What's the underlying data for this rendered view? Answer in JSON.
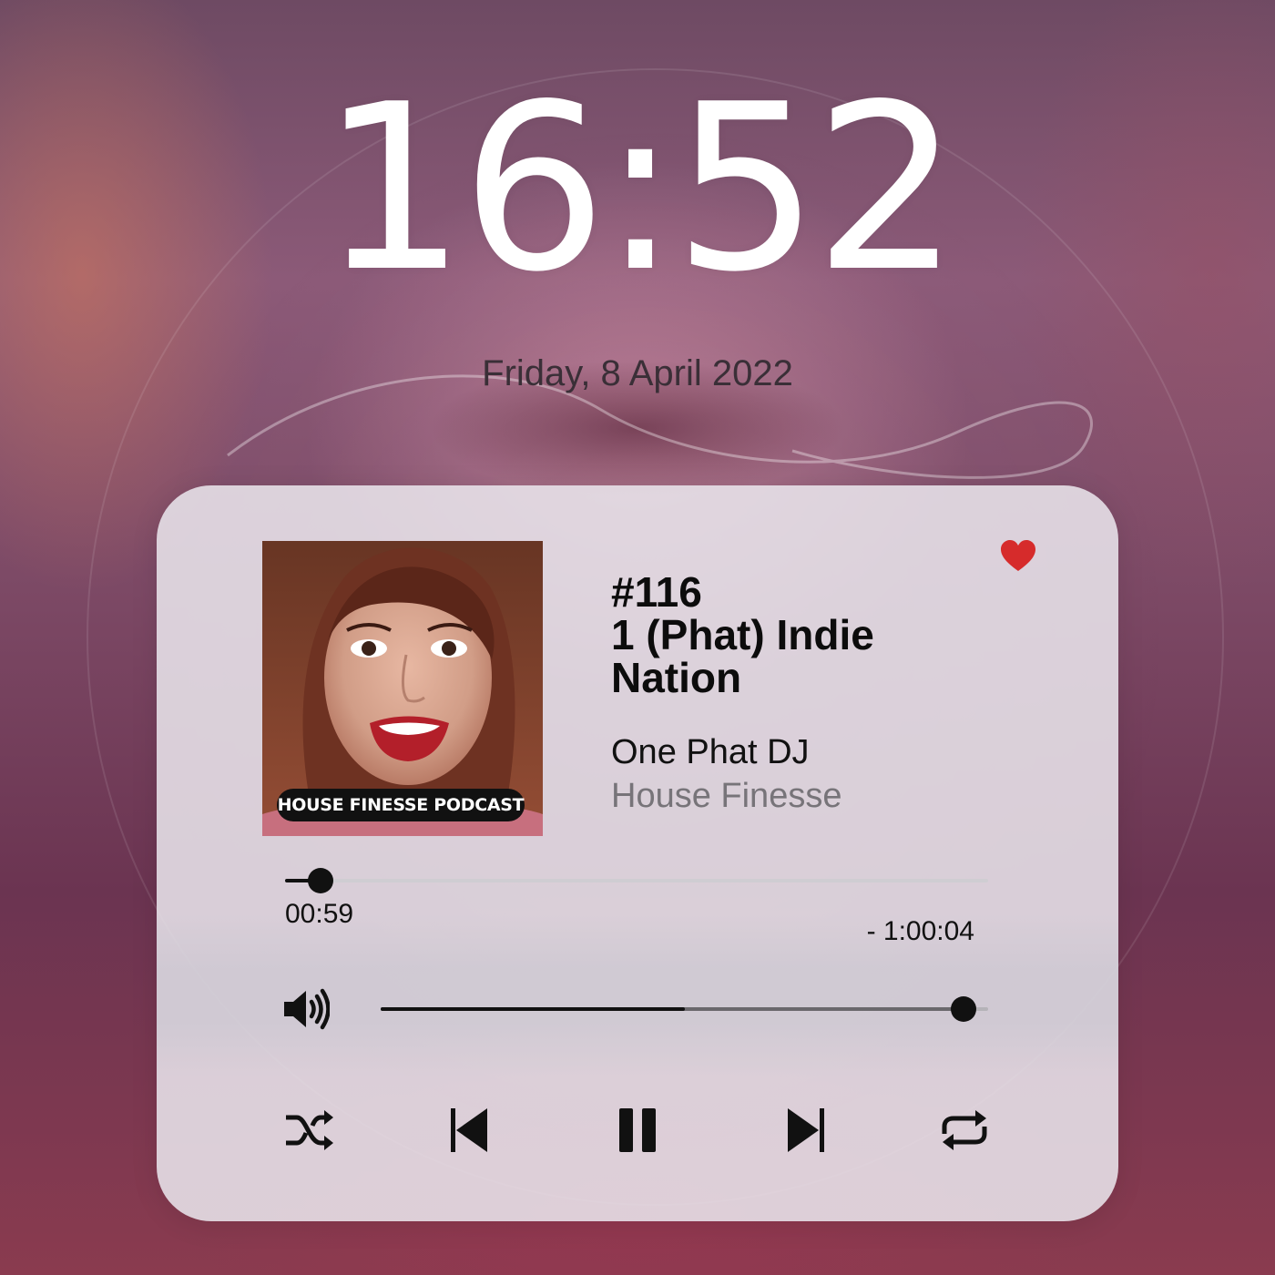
{
  "lock_screen": {
    "time": "16:52",
    "date": "Friday, 8 April 2022"
  },
  "player": {
    "artwork_badge": "HOUSE FINESSE PODCAST",
    "episode_number": "#116",
    "title_lines": [
      "1 (Phat) Indie",
      "Nation"
    ],
    "artist": "One Phat DJ",
    "show": "House Finesse",
    "liked": true,
    "progress": {
      "elapsed": "00:59",
      "remaining": "- 1:00:04",
      "fraction": 0.05
    },
    "volume": {
      "level": 0.96,
      "buffered": 0.5
    },
    "controls": [
      "shuffle-icon",
      "previous-icon",
      "pause-icon",
      "next-icon",
      "repeat-icon"
    ]
  },
  "colors": {
    "heart": "#d62b2b",
    "control": "#111111",
    "secondary_text": "#777479"
  }
}
